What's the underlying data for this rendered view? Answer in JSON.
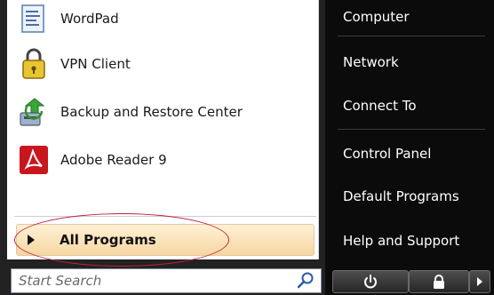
{
  "programs": [
    {
      "label": "WordPad",
      "icon": "wordpad-icon"
    },
    {
      "label": "VPN Client",
      "icon": "vpn-lock-icon"
    },
    {
      "label": "Backup and Restore Center",
      "icon": "backup-restore-icon"
    },
    {
      "label": "Adobe Reader 9",
      "icon": "adobe-reader-icon"
    }
  ],
  "all_programs": {
    "label": "All Programs"
  },
  "search": {
    "placeholder": "Start Search"
  },
  "right_menu": {
    "items": [
      {
        "label": "Computer"
      },
      {
        "label": "Network"
      },
      {
        "label": "Connect To"
      },
      {
        "label": "Control Panel"
      },
      {
        "label": "Default Programs"
      },
      {
        "label": "Help and Support"
      }
    ]
  },
  "colors": {
    "highlight": "#f6d6a2",
    "annotation": "#c2203a",
    "adobe_red": "#c9161d"
  }
}
